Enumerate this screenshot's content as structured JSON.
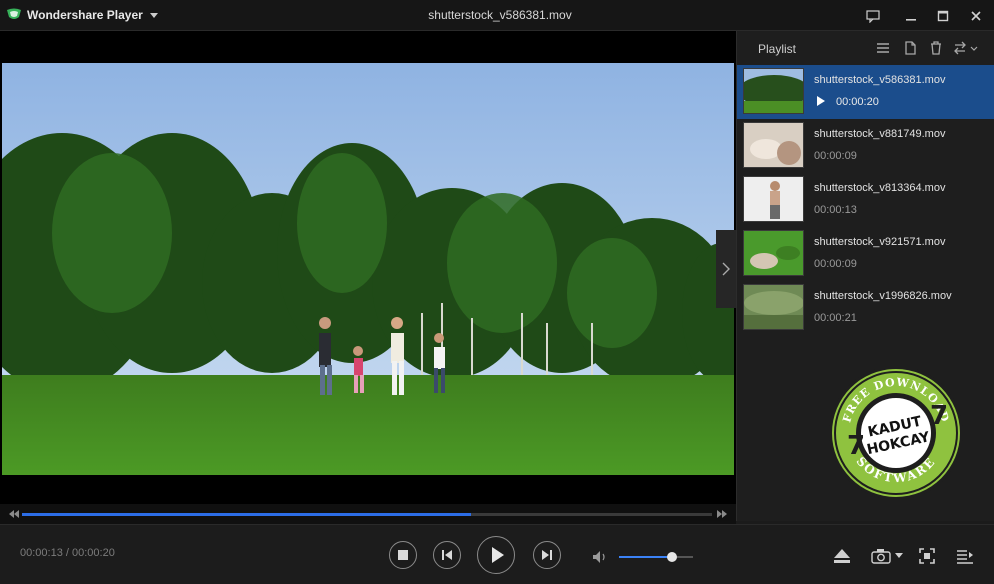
{
  "app": {
    "name": "Wondershare Player",
    "window_title": "shutterstock_v586381.mov"
  },
  "playlist": {
    "title": "Playlist",
    "items": [
      {
        "name": "shutterstock_v586381.mov",
        "duration": "00:00:20",
        "active": true
      },
      {
        "name": "shutterstock_v881749.mov",
        "duration": "00:00:09",
        "active": false
      },
      {
        "name": "shutterstock_v813364.mov",
        "duration": "00:00:13",
        "active": false
      },
      {
        "name": "shutterstock_v921571.mov",
        "duration": "00:00:09",
        "active": false
      },
      {
        "name": "shutterstock_v1996826.mov",
        "duration": "00:00:21",
        "active": false
      }
    ]
  },
  "player": {
    "time_readout": "00:00:13 / 00:00:20",
    "progress": 0.65,
    "volume": 0.72
  },
  "watermark": {
    "top_text": "FREE DOWNLOAD",
    "center_line1": "KADUT",
    "center_line2": "HOKCAY",
    "bottom_text": "SOFTWARE",
    "digit": "7"
  },
  "colors": {
    "accent": "#2c6de6",
    "active_row": "#1b4d8c",
    "badge_green": "#8fc23f"
  }
}
